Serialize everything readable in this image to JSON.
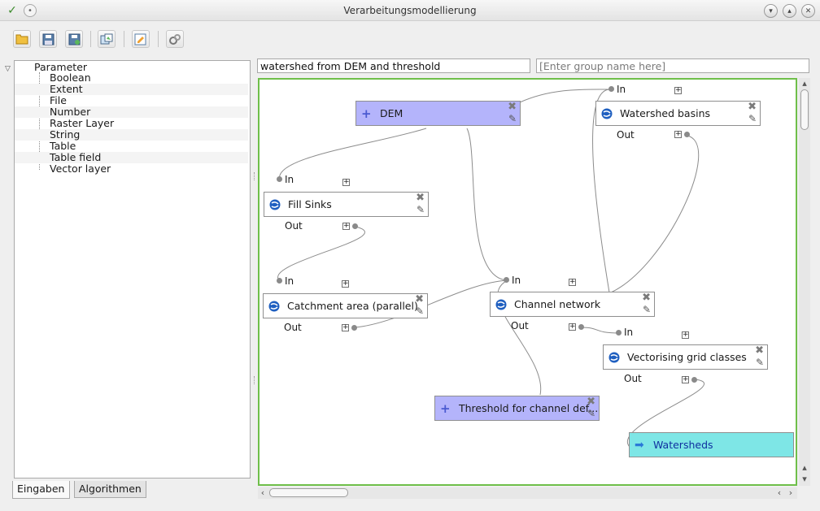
{
  "window": {
    "title": "Verarbeitungsmodellierung"
  },
  "toolbar": {
    "buttons": [
      "open-icon",
      "save-icon",
      "save-as-icon",
      "export-image-icon",
      "edit-help-icon",
      "run-model-icon"
    ]
  },
  "tree": {
    "root": "Parameter",
    "items": [
      "Boolean",
      "Extent",
      "File",
      "Number",
      "Raster Layer",
      "String",
      "Table",
      "Table field",
      "Vector layer"
    ]
  },
  "tabs": {
    "inputs": "Eingaben",
    "algorithms": "Algorithmen"
  },
  "model": {
    "name": "watershed from DEM and threshold",
    "group_placeholder": "[Enter group name here]"
  },
  "canvas": {
    "nodes": {
      "dem": "DEM",
      "fill_sinks": "Fill Sinks",
      "catchment": "Catchment area (parallel)",
      "threshold": "Threshold for channel def...",
      "channel_network": "Channel network",
      "watershed_basins": "Watershed basins",
      "vectorising": "Vectorising grid classes",
      "watersheds": "Watersheds"
    },
    "ports": {
      "in": "In",
      "out": "Out",
      "expand": "+"
    }
  },
  "colors": {
    "input_node": "#b4b4fb",
    "output_node": "#7ee6e6",
    "canvas_border": "#6fbf4a"
  }
}
